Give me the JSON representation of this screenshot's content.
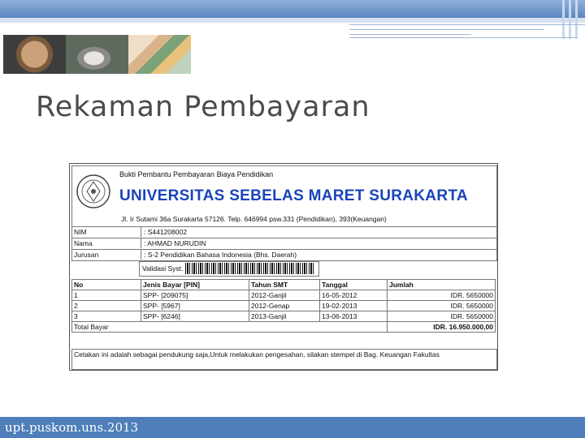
{
  "slide": {
    "title": "Rekaman Pembayaran",
    "footer": "upt.puskom.uns.2013"
  },
  "receipt": {
    "subtitle": "Bukti Pembantu Pembayaran Biaya Pendidikan",
    "university": "UNIVERSITAS SEBELAS MARET SURAKARTA",
    "address": "Jl. Ir Sutami 36a Surakarta 57126. Telp. 646994 psw.331 (Pendidikan), 393(Keuangan)",
    "fields": [
      {
        "label": "NIM",
        "value": ": S441208002"
      },
      {
        "label": "Nama",
        "value": ": AHMAD NURUDIN"
      },
      {
        "label": "Jurusan",
        "value": ": S-2 Pendidikan Bahasa Indonesia (Bhs. Daerah)"
      }
    ],
    "validation_label": "Validasi Syst.",
    "table": {
      "headers": [
        "No",
        "Jenis Bayar [PIN]",
        "Tahun SMT",
        "Tanggal",
        "Jumlah"
      ],
      "rows": [
        [
          "1",
          "SPP- [209075]",
          "2012-Ganjil",
          "16-05-2012",
          "IDR. 5650000"
        ],
        [
          "2",
          "SPP- [5967]",
          "2012-Genap",
          "19-02-2013",
          "IDR. 5650000"
        ],
        [
          "3",
          "SPP- [6246]",
          "2013-Ganjil",
          "13-06-2013",
          "IDR. 5650000"
        ]
      ],
      "total_label": "Total Bayar",
      "total_value": "IDR. 16.950.000,00"
    },
    "note": "Cetakan ini adalah sebagai pendukung saja,Untuk melakukan pengesahan, silakan stempel di Bag. Keuangan Fakultas"
  },
  "colors": {
    "header_bar": "#5b86bf",
    "footer_bar": "#4f7fba",
    "university_blue": "#1a44b8"
  }
}
